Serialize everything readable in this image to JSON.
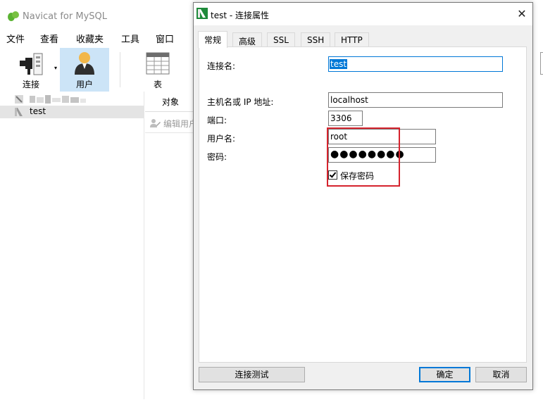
{
  "app": {
    "title": "Navicat for MySQL"
  },
  "menu": [
    "文件",
    "查看",
    "收藏夹",
    "工具",
    "窗口"
  ],
  "toolbar": {
    "connect": "连接",
    "user": "用户",
    "table": "表"
  },
  "tree": {
    "connection": "test"
  },
  "objects": {
    "tab": "对象",
    "edit_user": "编辑用户"
  },
  "dialog": {
    "title": "test - 连接属性",
    "tabs": [
      "常规",
      "高级",
      "SSL",
      "SSH",
      "HTTP"
    ],
    "fields": {
      "conn_name_label": "连接名:",
      "conn_name": "test",
      "host_label": "主机名或 IP 地址:",
      "host": "localhost",
      "port_label": "端口:",
      "port": "3306",
      "user_label": "用户名:",
      "user": "root",
      "password_label": "密码:",
      "password_mask": "●●●●●●●●"
    },
    "save_password": {
      "label": "保存密码",
      "checked": true
    },
    "buttons": {
      "test": "连接测试",
      "ok": "确定",
      "cancel": "取消"
    }
  },
  "colors": {
    "highlight": "#d5232d",
    "accent": "#0078d7",
    "selected_tool": "#cce4f7"
  }
}
